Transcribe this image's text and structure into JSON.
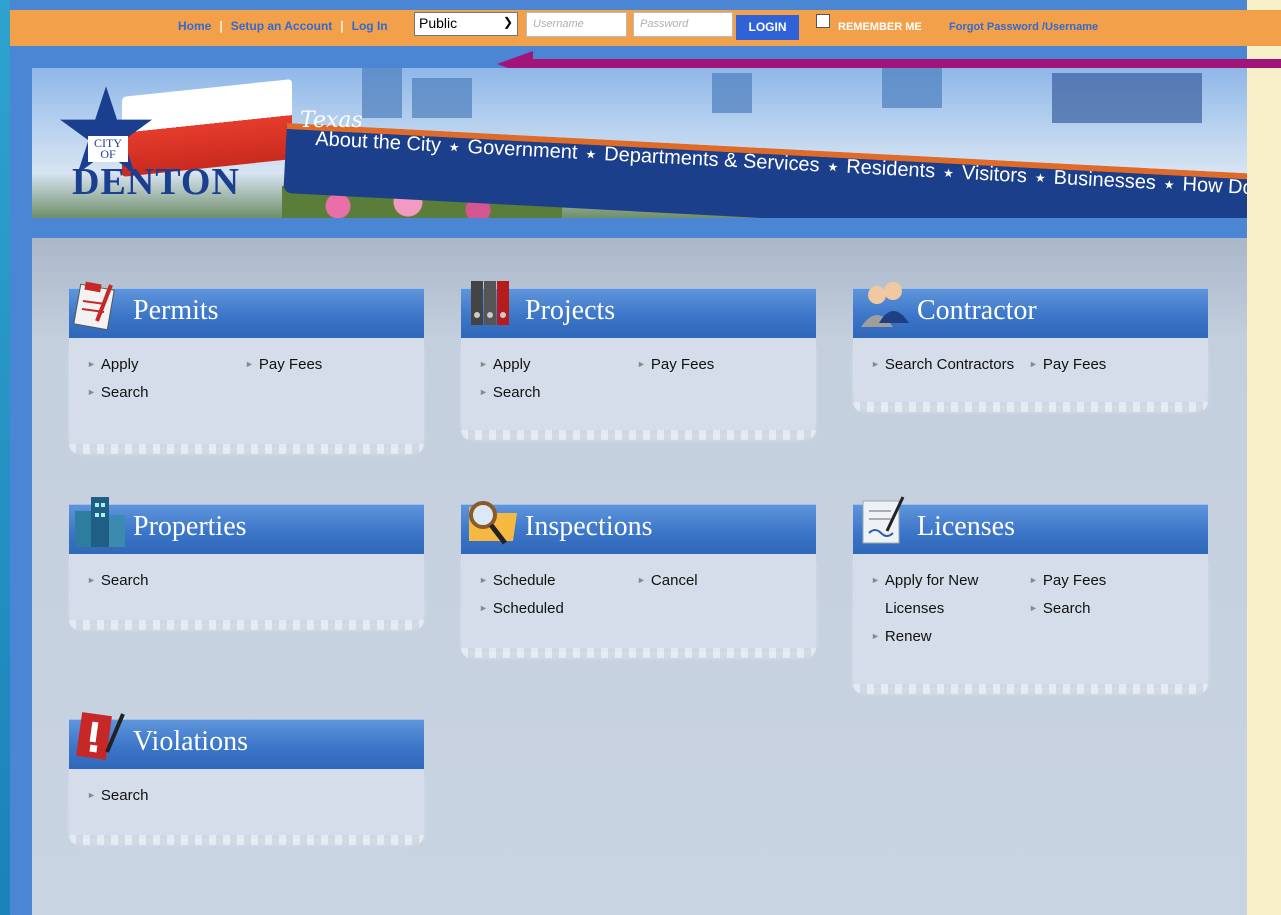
{
  "topbar": {
    "links": [
      "Home",
      "Setup an Account",
      "Log In"
    ],
    "separator": "|",
    "role_select": "Public",
    "username_placeholder": "Username",
    "password_placeholder": "Password",
    "login_button": "LOGIN",
    "remember_me": "REMEMBER ME",
    "forgot": "Forgot Password /Username"
  },
  "banner": {
    "logo_city_of": "CITY OF",
    "logo_name": "DENTON",
    "state_script": "Texas",
    "menu": [
      "About the City",
      "Government",
      "Departments & Services",
      "Residents",
      "Visitors",
      "Businesses",
      "How Do I..."
    ]
  },
  "cards": {
    "permits": {
      "title": "Permits",
      "links": [
        "Apply",
        "Search",
        "Pay Fees"
      ]
    },
    "projects": {
      "title": "Projects",
      "links": [
        "Apply",
        "Search",
        "Pay Fees"
      ]
    },
    "contractor": {
      "title": "Contractor",
      "links": [
        "Search Contractors",
        "Pay Fees"
      ]
    },
    "properties": {
      "title": "Properties",
      "links": [
        "Search"
      ]
    },
    "inspections": {
      "title": "Inspections",
      "links": [
        "Schedule",
        "Scheduled",
        "Cancel"
      ]
    },
    "licenses": {
      "title": "Licenses",
      "links": [
        "Apply for New",
        "Licenses",
        "Renew",
        "Pay Fees",
        "Search"
      ]
    },
    "violations": {
      "title": "Violations",
      "links": [
        "Search"
      ]
    }
  },
  "colors": {
    "topbar": "#f3a04a",
    "frame": "#4a86d4",
    "card_header": "#3c76c8",
    "annotation_arrow": "#a1147a"
  }
}
